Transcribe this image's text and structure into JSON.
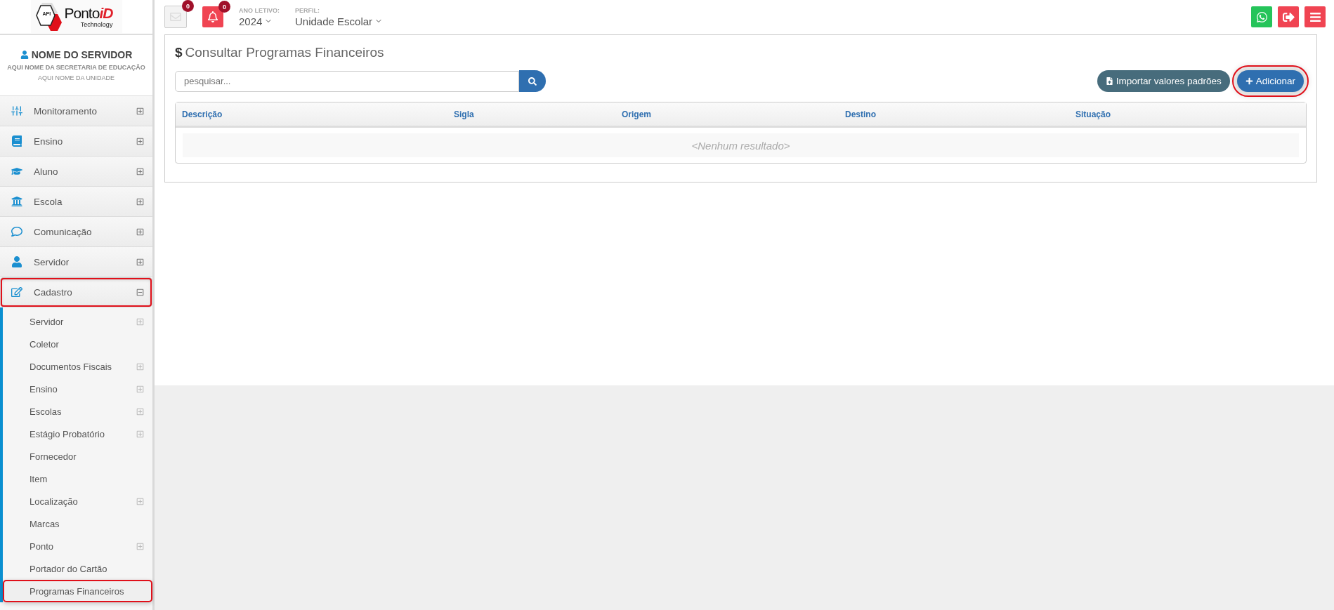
{
  "header": {
    "logo": {
      "badge": "API",
      "brand": "Ponto",
      "brand_accent": "iD",
      "tagline": "Technology"
    },
    "messages_count": "0",
    "alerts_count": "0",
    "year": {
      "label": "ANO LETIVO:",
      "value": "2024"
    },
    "profile": {
      "label": "PERFIL:",
      "value": "Unidade Escolar"
    }
  },
  "user": {
    "name": "NOME DO SERVIDOR",
    "department": "AQUI NOME DA SECRETARIA DE EDUCAÇÃO",
    "unit": "AQUI NOME DA UNIDADE"
  },
  "sidebar": {
    "items": [
      {
        "label": "Monitoramento",
        "expanded": false,
        "highlighted": false
      },
      {
        "label": "Ensino",
        "expanded": false,
        "highlighted": false
      },
      {
        "label": "Aluno",
        "expanded": false,
        "highlighted": false
      },
      {
        "label": "Escola",
        "expanded": false,
        "highlighted": false
      },
      {
        "label": "Comunicação",
        "expanded": false,
        "highlighted": false
      },
      {
        "label": "Servidor",
        "expanded": false,
        "highlighted": false
      },
      {
        "label": "Cadastro",
        "expanded": true,
        "highlighted": true,
        "children": [
          {
            "label": "Servidor",
            "expandable": true,
            "highlighted": false
          },
          {
            "label": "Coletor",
            "expandable": false,
            "highlighted": false
          },
          {
            "label": "Documentos Fiscais",
            "expandable": true,
            "highlighted": false
          },
          {
            "label": "Ensino",
            "expandable": true,
            "highlighted": false
          },
          {
            "label": "Escolas",
            "expandable": true,
            "highlighted": false
          },
          {
            "label": "Estágio Probatório",
            "expandable": true,
            "highlighted": false
          },
          {
            "label": "Fornecedor",
            "expandable": false,
            "highlighted": false
          },
          {
            "label": "Item",
            "expandable": false,
            "highlighted": false
          },
          {
            "label": "Localização",
            "expandable": true,
            "highlighted": false
          },
          {
            "label": "Marcas",
            "expandable": false,
            "highlighted": false
          },
          {
            "label": "Ponto",
            "expandable": true,
            "highlighted": false
          },
          {
            "label": "Portador do Cartão",
            "expandable": false,
            "highlighted": false
          },
          {
            "label": "Programas Financeiros",
            "expandable": false,
            "highlighted": true
          }
        ]
      }
    ]
  },
  "page": {
    "title_icon": "$",
    "title": "Consultar Programas Financeiros",
    "search": {
      "placeholder": "pesquisar..."
    },
    "buttons": [
      {
        "label": "Importar valores padrões",
        "kind": "import",
        "highlighted": false
      },
      {
        "label": "Adicionar",
        "kind": "add",
        "highlighted": true
      }
    ],
    "table": {
      "columns": [
        "Descrição",
        "Sigla",
        "Origem",
        "Destino",
        "Situação"
      ],
      "empty_message": "<Nenhum resultado>"
    }
  }
}
